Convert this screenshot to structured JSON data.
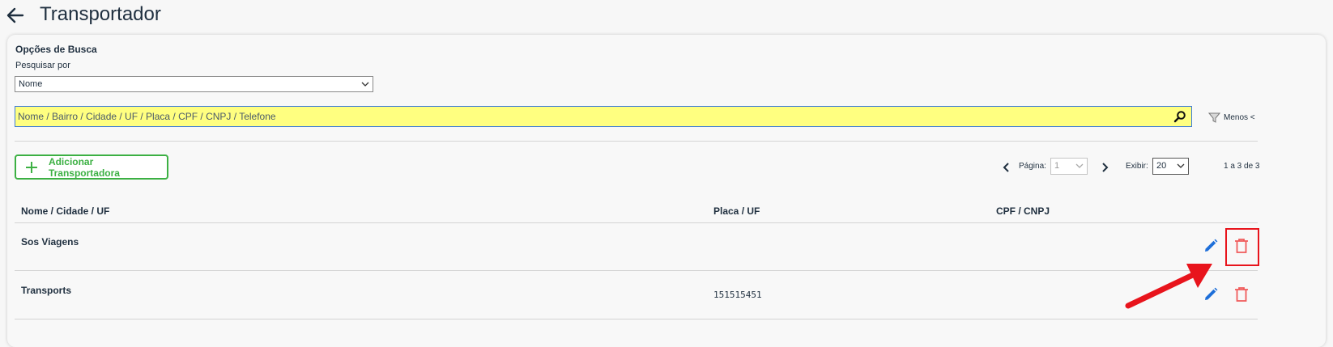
{
  "header": {
    "title": "Transportador",
    "back_icon": "arrow-left-icon"
  },
  "search": {
    "section_title": "Opções de Busca",
    "search_by_label": "Pesquisar por",
    "search_by_value": "Nome",
    "input_placeholder": "Nome / Bairro / Cidade / UF / Placa / CPF / CNPJ / Telefone",
    "filter_toggle_label": "Menos <"
  },
  "toolbar": {
    "add_label": "Adicionar Transportadora"
  },
  "pager": {
    "page_label": "Página:",
    "page_value": "1",
    "show_label": "Exibir:",
    "show_value": "20",
    "range_label": "1 a 3 de 3"
  },
  "table": {
    "columns": [
      "Nome / Cidade / UF",
      "Placa / UF",
      "CPF / CNPJ"
    ],
    "rows": [
      {
        "name": "Sos Viagens",
        "plate": ""
      },
      {
        "name": "Transports",
        "plate": "151515451"
      }
    ]
  },
  "colors": {
    "accent_green": "#3cb043",
    "edit_blue": "#1e6fd9",
    "delete_red": "#e8141c",
    "search_bg": "#ffff80"
  }
}
